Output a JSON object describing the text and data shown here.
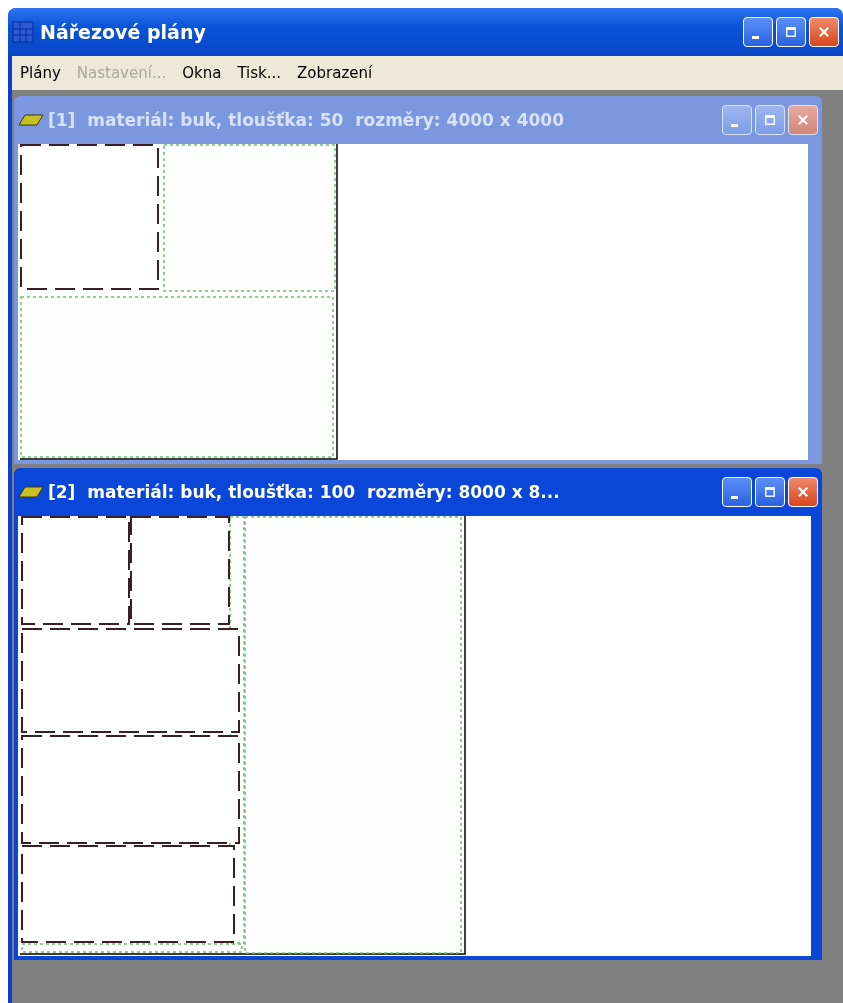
{
  "window": {
    "title": "Nářezové plány"
  },
  "menu": [
    {
      "label": "Plány",
      "disabled": false
    },
    {
      "label": "Nastavení...",
      "disabled": true
    },
    {
      "label": "Okna",
      "disabled": false
    },
    {
      "label": "Tisk...",
      "disabled": false
    },
    {
      "label": "Zobrazení",
      "disabled": false
    }
  ],
  "child_windows": [
    {
      "title": "[1]  materiál: buk, tloušťka: 50  rozměry: 4000 x 4000",
      "active": false
    },
    {
      "title": "[2]  materiál: buk, tloušťka: 100  rozměry: 8000 x 8...",
      "active": true
    }
  ]
}
